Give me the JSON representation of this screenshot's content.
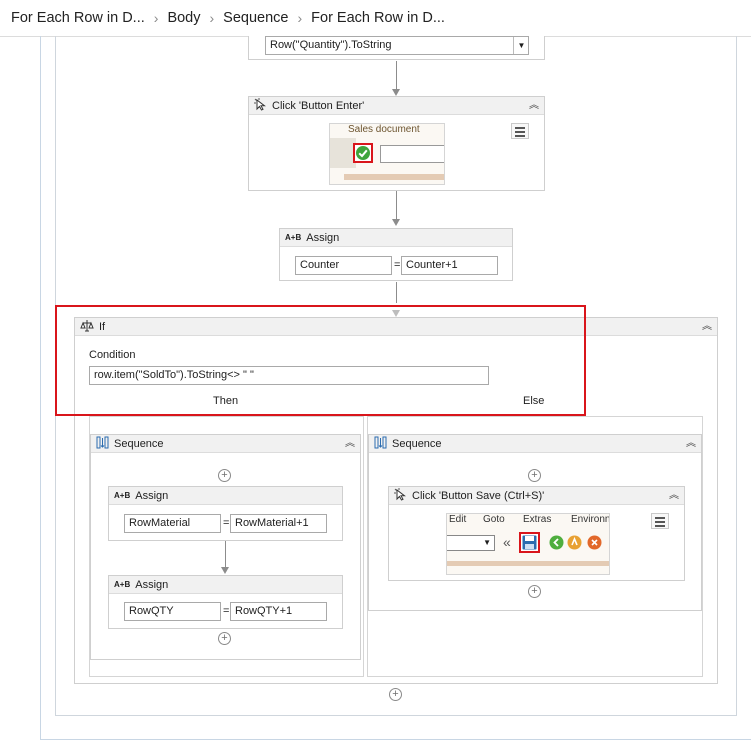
{
  "breadcrumb": {
    "items": [
      "For Each Row in D...",
      "Body",
      "Sequence",
      "For Each Row in D..."
    ]
  },
  "top_select": {
    "value": "Row(\"Quantity\").ToString",
    "icon": "dropdown-arrow"
  },
  "click_enter": {
    "title": "Click 'Button  Enter'",
    "screenshot_text": "Sales document"
  },
  "assign_counter": {
    "title": "Assign",
    "left": "Counter",
    "eq": "=",
    "right": "Counter+1"
  },
  "if_activity": {
    "title": "If",
    "condition_label": "Condition",
    "condition_value": "row.item(\"SoldTo\").ToString<> \" \"",
    "then_label": "Then",
    "else_label": "Else"
  },
  "then_sequence": {
    "title": "Sequence",
    "assign1": {
      "title": "Assign",
      "left": "RowMaterial",
      "eq": "=",
      "right": "RowMaterial+1"
    },
    "assign2": {
      "title": "Assign",
      "left": "RowQTY",
      "eq": "=",
      "right": "RowQTY+1"
    }
  },
  "else_sequence": {
    "title": "Sequence",
    "click_save": {
      "title": "Click 'Button  Save (Ctrl+S)'",
      "menu_edit": "Edit",
      "menu_goto": "Goto",
      "menu_extras": "Extras",
      "menu_environ": "Environn"
    }
  },
  "colors": {
    "highlight": "#d9151b",
    "accent": "#2b6cb0"
  }
}
